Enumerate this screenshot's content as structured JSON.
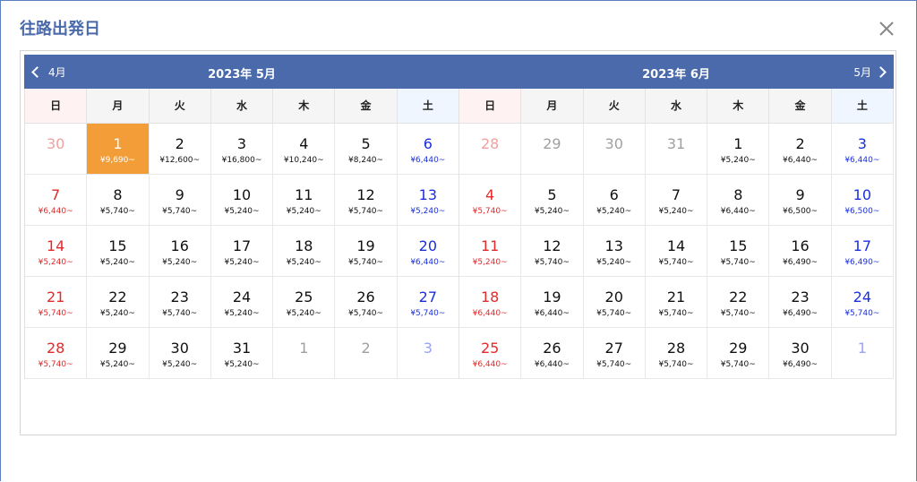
{
  "dialog": {
    "title": "往路出発日"
  },
  "weekdays": [
    "日",
    "月",
    "火",
    "水",
    "木",
    "金",
    "土"
  ],
  "months": [
    {
      "title": "2023年 5月",
      "nav_prev": "4月",
      "weeks": [
        [
          {
            "d": "30",
            "p": "",
            "c": "red",
            "o": true
          },
          {
            "d": "1",
            "p": "¥9,690~",
            "c": "black",
            "sel": true
          },
          {
            "d": "2",
            "p": "¥12,600~",
            "c": "black"
          },
          {
            "d": "3",
            "p": "¥16,800~",
            "c": "black"
          },
          {
            "d": "4",
            "p": "¥10,240~",
            "c": "black"
          },
          {
            "d": "5",
            "p": "¥8,240~",
            "c": "black"
          },
          {
            "d": "6",
            "p": "¥6,440~",
            "c": "blue"
          }
        ],
        [
          {
            "d": "7",
            "p": "¥6,440~",
            "c": "red"
          },
          {
            "d": "8",
            "p": "¥5,740~",
            "c": "black"
          },
          {
            "d": "9",
            "p": "¥5,740~",
            "c": "black"
          },
          {
            "d": "10",
            "p": "¥5,240~",
            "c": "black"
          },
          {
            "d": "11",
            "p": "¥5,240~",
            "c": "black"
          },
          {
            "d": "12",
            "p": "¥5,740~",
            "c": "black"
          },
          {
            "d": "13",
            "p": "¥5,240~",
            "c": "blue"
          }
        ],
        [
          {
            "d": "14",
            "p": "¥5,240~",
            "c": "red"
          },
          {
            "d": "15",
            "p": "¥5,240~",
            "c": "black"
          },
          {
            "d": "16",
            "p": "¥5,240~",
            "c": "black"
          },
          {
            "d": "17",
            "p": "¥5,240~",
            "c": "black"
          },
          {
            "d": "18",
            "p": "¥5,240~",
            "c": "black"
          },
          {
            "d": "19",
            "p": "¥5,740~",
            "c": "black"
          },
          {
            "d": "20",
            "p": "¥6,440~",
            "c": "blue"
          }
        ],
        [
          {
            "d": "21",
            "p": "¥5,740~",
            "c": "red"
          },
          {
            "d": "22",
            "p": "¥5,240~",
            "c": "black"
          },
          {
            "d": "23",
            "p": "¥5,740~",
            "c": "black"
          },
          {
            "d": "24",
            "p": "¥5,240~",
            "c": "black"
          },
          {
            "d": "25",
            "p": "¥5,240~",
            "c": "black"
          },
          {
            "d": "26",
            "p": "¥5,740~",
            "c": "black"
          },
          {
            "d": "27",
            "p": "¥5,740~",
            "c": "blue"
          }
        ],
        [
          {
            "d": "28",
            "p": "¥5,740~",
            "c": "red"
          },
          {
            "d": "29",
            "p": "¥5,240~",
            "c": "black"
          },
          {
            "d": "30",
            "p": "¥5,240~",
            "c": "black"
          },
          {
            "d": "31",
            "p": "¥5,240~",
            "c": "black"
          },
          {
            "d": "1",
            "p": "",
            "c": "black",
            "o": true
          },
          {
            "d": "2",
            "p": "",
            "c": "black",
            "o": true
          },
          {
            "d": "3",
            "p": "",
            "c": "blue",
            "o": true
          }
        ]
      ]
    },
    {
      "title": "2023年 6月",
      "nav_next": "5月",
      "weeks": [
        [
          {
            "d": "28",
            "p": "",
            "c": "red",
            "o": true
          },
          {
            "d": "29",
            "p": "",
            "c": "black",
            "o": true
          },
          {
            "d": "30",
            "p": "",
            "c": "black",
            "o": true
          },
          {
            "d": "31",
            "p": "",
            "c": "black",
            "o": true
          },
          {
            "d": "1",
            "p": "¥5,240~",
            "c": "black"
          },
          {
            "d": "2",
            "p": "¥6,440~",
            "c": "black"
          },
          {
            "d": "3",
            "p": "¥6,440~",
            "c": "blue"
          }
        ],
        [
          {
            "d": "4",
            "p": "¥5,740~",
            "c": "red"
          },
          {
            "d": "5",
            "p": "¥5,240~",
            "c": "black"
          },
          {
            "d": "6",
            "p": "¥5,240~",
            "c": "black"
          },
          {
            "d": "7",
            "p": "¥5,240~",
            "c": "black"
          },
          {
            "d": "8",
            "p": "¥6,440~",
            "c": "black"
          },
          {
            "d": "9",
            "p": "¥6,500~",
            "c": "black"
          },
          {
            "d": "10",
            "p": "¥6,500~",
            "c": "blue"
          }
        ],
        [
          {
            "d": "11",
            "p": "¥5,240~",
            "c": "red"
          },
          {
            "d": "12",
            "p": "¥5,740~",
            "c": "black"
          },
          {
            "d": "13",
            "p": "¥5,240~",
            "c": "black"
          },
          {
            "d": "14",
            "p": "¥5,740~",
            "c": "black"
          },
          {
            "d": "15",
            "p": "¥5,740~",
            "c": "black"
          },
          {
            "d": "16",
            "p": "¥6,490~",
            "c": "black"
          },
          {
            "d": "17",
            "p": "¥6,490~",
            "c": "blue"
          }
        ],
        [
          {
            "d": "18",
            "p": "¥6,440~",
            "c": "red"
          },
          {
            "d": "19",
            "p": "¥6,440~",
            "c": "black"
          },
          {
            "d": "20",
            "p": "¥5,740~",
            "c": "black"
          },
          {
            "d": "21",
            "p": "¥5,740~",
            "c": "black"
          },
          {
            "d": "22",
            "p": "¥5,740~",
            "c": "black"
          },
          {
            "d": "23",
            "p": "¥6,490~",
            "c": "black"
          },
          {
            "d": "24",
            "p": "¥5,740~",
            "c": "blue"
          }
        ],
        [
          {
            "d": "25",
            "p": "¥6,440~",
            "c": "red"
          },
          {
            "d": "26",
            "p": "¥6,440~",
            "c": "black"
          },
          {
            "d": "27",
            "p": "¥5,740~",
            "c": "black"
          },
          {
            "d": "28",
            "p": "¥5,740~",
            "c": "black"
          },
          {
            "d": "29",
            "p": "¥5,740~",
            "c": "black"
          },
          {
            "d": "30",
            "p": "¥6,490~",
            "c": "black"
          },
          {
            "d": "1",
            "p": "",
            "c": "blue",
            "o": true
          }
        ]
      ]
    }
  ]
}
